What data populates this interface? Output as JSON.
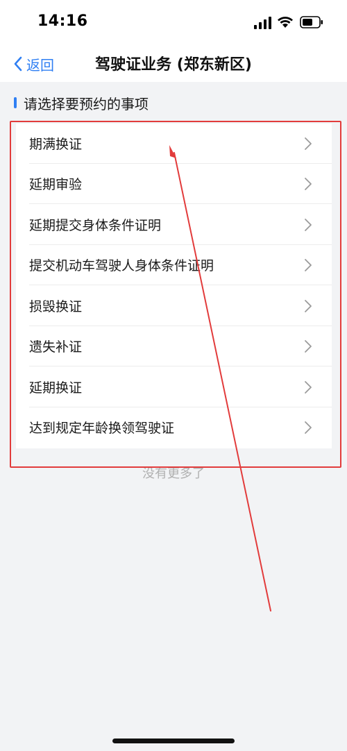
{
  "status_bar": {
    "time": "14:16",
    "signal_icon": "cellular-signal-icon",
    "wifi_icon": "wifi-icon",
    "battery_icon": "battery-icon"
  },
  "nav": {
    "back_label": "返回",
    "back_icon": "chevron-left-icon",
    "title": "驾驶证业务 (郑东新区)"
  },
  "section": {
    "title": "请选择要预约的事项"
  },
  "items": [
    {
      "label": "期满换证"
    },
    {
      "label": "延期审验"
    },
    {
      "label": "延期提交身体条件证明"
    },
    {
      "label": "提交机动车驾驶人身体条件证明"
    },
    {
      "label": "损毁换证"
    },
    {
      "label": "遗失补证"
    },
    {
      "label": "延期换证"
    },
    {
      "label": "达到规定年龄换领驾驶证"
    }
  ],
  "footer": {
    "text": "没有更多了"
  },
  "colors": {
    "accent": "#2f7ff3",
    "annotation": "#e23b3b",
    "background": "#f2f3f5"
  }
}
